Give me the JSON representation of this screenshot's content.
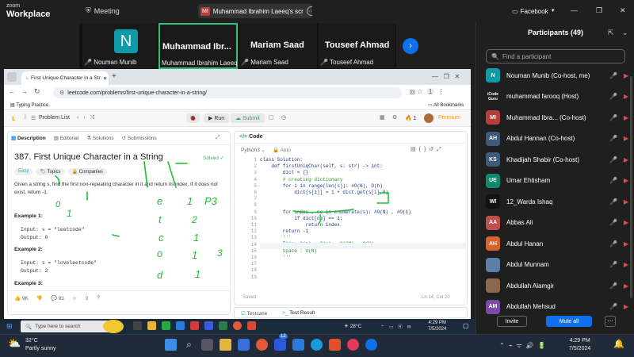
{
  "zoom": {
    "logo_top": "zoom",
    "logo_bottom": "Workplace",
    "meeting_label": "Meeting",
    "share_badge": "MI",
    "share_title": "Muhammad Ibrahim Laeeq's scr",
    "view_label": "Facebook"
  },
  "video_tiles": [
    {
      "initial": "N",
      "name": "Nouman Munib"
    },
    {
      "title": "Muhammad  Ibr...",
      "name": "Muhammad Ibrahim Laeeq"
    },
    {
      "title": "Mariam Saad",
      "name": "Mariam Saad"
    },
    {
      "title": "Touseef Ahmad",
      "name": "Touseef Ahmad"
    }
  ],
  "browser": {
    "tab_title": "First Unique Character in a Str",
    "url": "leetcode.com/problems/first-unique-character-in-a-string/",
    "bookmark": "Typing Practice",
    "all_bookmarks": "All Bookmarks"
  },
  "leetcode": {
    "problem_list": "Problem List",
    "run": "Run",
    "submit": "Submit",
    "streak": "1",
    "premium": "Premium",
    "tabs": [
      "Description",
      "Editorial",
      "Solutions",
      "Submissions"
    ],
    "code_tab": "Code",
    "title": "387. First Unique Character in a String",
    "solved": "Solved",
    "tags": [
      "Easy",
      "Topics",
      "Companies"
    ],
    "desc1": "Given a string s, find the first non-repeating character in it and return its index. If it does not",
    "desc2": "exist, return -1.",
    "ex1": "Example 1:",
    "ex1_in": "Input: s = \"leetcode\"",
    "ex1_out": "Output: 0",
    "ex2": "Example 2:",
    "ex2_in": "Input: s = \"loveleetcode\"",
    "ex2_out": "Output: 2",
    "ex3": "Example 3:",
    "likes": "9K",
    "comments": "91",
    "lang": "Python3",
    "auto": "Auto",
    "saved": "Saved",
    "cursor": "Ln 14, Col 20",
    "testcase": "Testcase",
    "test_result": "Test Result"
  },
  "code_lines": [
    "class Solution:",
    "    def firstUniqChar(self, s: str) -> int:",
    "        dict = {}",
    "        # creating dictionary",
    "        for i in range(len(s)): #O(N), O(h)",
    "            dict[s[i]] = 1 + dict.get(s[i],0)",
    "",
    "",
    "        for index , no in enumerate(s): #O(N) , #O(1)",
    "            if dict[no] == 1:",
    "                return index",
    "        return -1",
    "        '''",
    "        Time: O(n) + O(n) = O(2N) = O(N)",
    "        Space : O(N)",
    "        '''",
    "",
    "",
    ""
  ],
  "participants": {
    "title": "Participants (49)",
    "search_placeholder": "Find a participant",
    "list": [
      {
        "av": "N",
        "color": "#0e9aa7",
        "name": "Nouman Munib (Co-host, me)"
      },
      {
        "av": "iCode Guru",
        "color": "#1f1f1f",
        "name": "muhammad farooq (Host)"
      },
      {
        "av": "MI",
        "color": "#b43f3f",
        "name": "Muhammad Ibra... (Co-host)"
      },
      {
        "av": "AH",
        "color": "#3e5a7a",
        "name": "Abdul Hannan (Co-host)"
      },
      {
        "av": "KS",
        "color": "#3e5a7a",
        "name": "Khadijah Shabir (Co-host)"
      },
      {
        "av": "UE",
        "color": "#118a6a",
        "name": "Umar Ehtisham"
      },
      {
        "av": "WI",
        "color": "#111111",
        "name": "12_Warda Ishaq"
      },
      {
        "av": "AA",
        "color": "#c0504d",
        "name": "Abbas Ali"
      },
      {
        "av": "AH",
        "color": "#d9622b",
        "name": "Abdul Hanan"
      },
      {
        "av": "",
        "color": "#5b7fa8",
        "name": "Abdul Munnam"
      },
      {
        "av": "",
        "color": "#8a6a4a",
        "name": "Abdullah Alamgir"
      },
      {
        "av": "AM",
        "color": "#7a4aa8",
        "name": "Abdullah Mehsud"
      }
    ],
    "invite": "Invite",
    "mute_all": "Mute all"
  },
  "remote_taskbar": {
    "search": "Type here to search",
    "temp": "28°C",
    "time": "4:29 PM",
    "date": "7/5/2024"
  },
  "local_taskbar": {
    "temp": "32°C",
    "weather": "Partly sunny",
    "time": "4:29 PM",
    "date": "7/5/2024",
    "badge": "12"
  },
  "annotations": {
    "e": "e",
    "t": "t",
    "c": "c",
    "o": "o",
    "d": "d",
    "v1": "1",
    "v2": "2",
    "p3": "P3",
    "v3": "1",
    "v4": "1",
    "v5": "1",
    "v6": "1",
    "three": "3",
    "zero": "0",
    "one": "1"
  }
}
